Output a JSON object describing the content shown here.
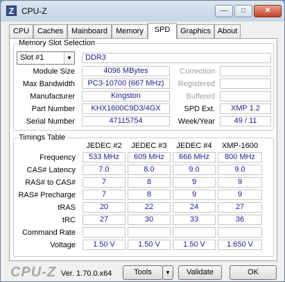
{
  "window": {
    "title": "CPU-Z",
    "icon_letter": "Z"
  },
  "tabs": [
    {
      "label": "CPU"
    },
    {
      "label": "Caches"
    },
    {
      "label": "Mainboard"
    },
    {
      "label": "Memory"
    },
    {
      "label": "SPD"
    },
    {
      "label": "Graphics"
    },
    {
      "label": "About"
    }
  ],
  "active_tab": "SPD",
  "slot": {
    "title": "Memory Slot Selection",
    "selected": "Slot #1",
    "type": "DDR3",
    "module_size_label": "Module Size",
    "module_size": "4096 MBytes",
    "max_bandwidth_label": "Max Bandwidth",
    "max_bandwidth": "PC3-10700 (667 MHz)",
    "manufacturer_label": "Manufacturer",
    "manufacturer": "Kingston",
    "part_number_label": "Part Number",
    "part_number": "KHX1600C9D3/4GX",
    "serial_number_label": "Serial Number",
    "serial_number": "47115754",
    "correction_label": "Correction",
    "correction": "",
    "registered_label": "Registered",
    "registered": "",
    "buffered_label": "Buffered",
    "buffered": "",
    "spd_ext_label": "SPD Ext.",
    "spd_ext": "XMP 1.2",
    "week_year_label": "Week/Year",
    "week_year": "49 / 11"
  },
  "timings": {
    "title": "Timings Table",
    "columns": [
      "JEDEC #2",
      "JEDEC #3",
      "JEDEC #4",
      "XMP-1600"
    ],
    "rows": [
      {
        "label": "Frequency",
        "values": [
          "533 MHz",
          "609 MHz",
          "666 MHz",
          "800 MHz"
        ]
      },
      {
        "label": "CAS# Latency",
        "values": [
          "7.0",
          "8.0",
          "9.0",
          "9.0"
        ]
      },
      {
        "label": "RAS# to CAS#",
        "values": [
          "7",
          "8",
          "9",
          "9"
        ]
      },
      {
        "label": "RAS# Precharge",
        "values": [
          "7",
          "8",
          "9",
          "9"
        ]
      },
      {
        "label": "tRAS",
        "values": [
          "20",
          "22",
          "24",
          "27"
        ]
      },
      {
        "label": "tRC",
        "values": [
          "27",
          "30",
          "33",
          "36"
        ]
      },
      {
        "label": "Command Rate",
        "values": [
          "",
          "",
          "",
          ""
        ]
      },
      {
        "label": "Voltage",
        "values": [
          "1.50 V",
          "1.50 V",
          "1.50 V",
          "1.650 V"
        ]
      }
    ]
  },
  "footer": {
    "logo": "CPU-Z",
    "version": "Ver. 1.70.0.x64",
    "tools_label": "Tools",
    "validate_label": "Validate",
    "ok_label": "OK"
  }
}
